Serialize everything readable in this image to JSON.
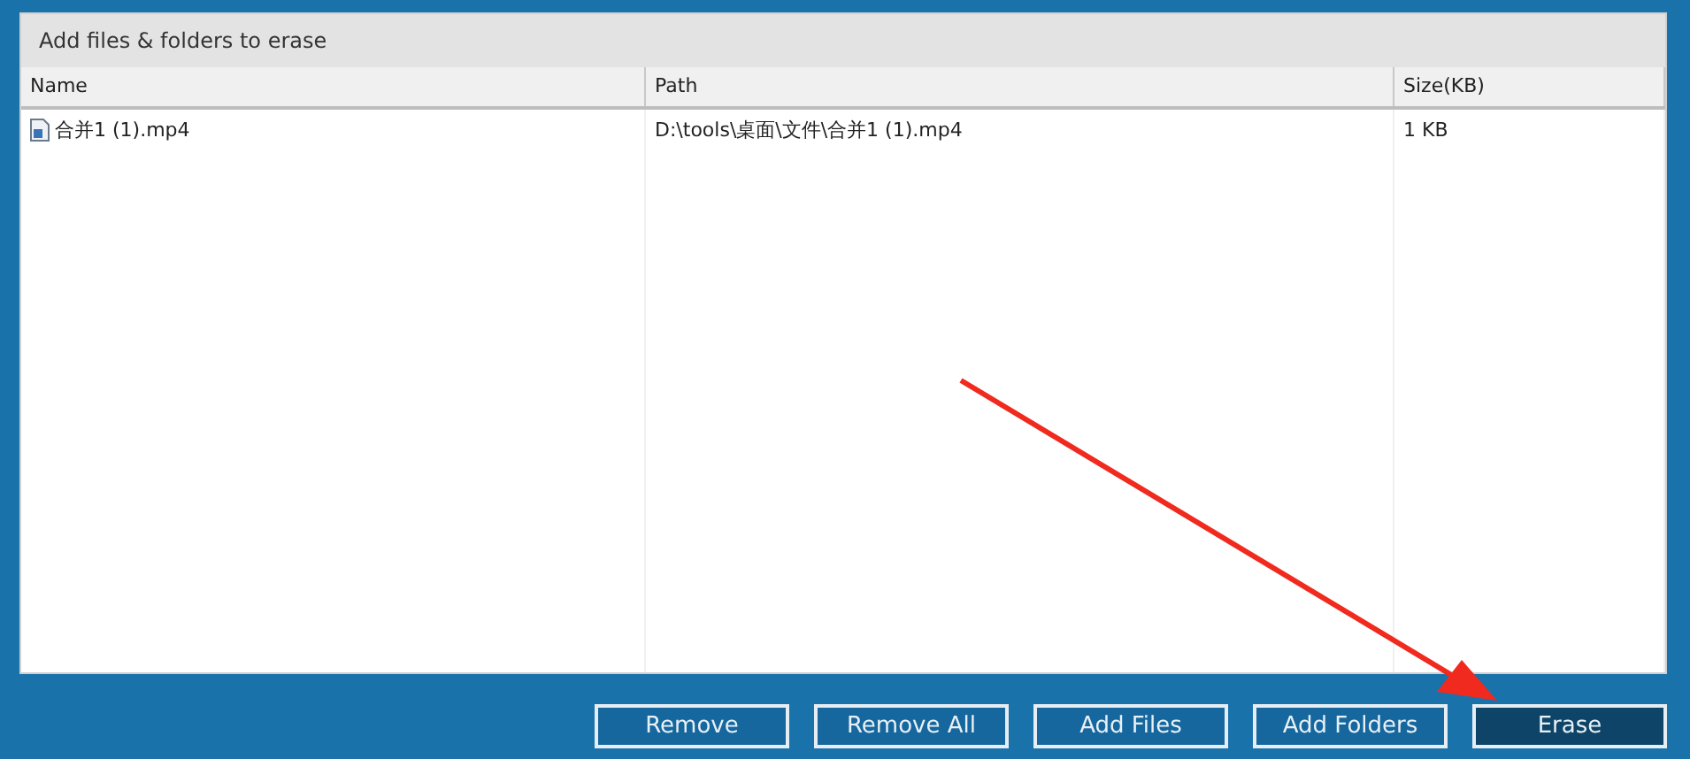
{
  "panel": {
    "title": "Add files & folders to erase"
  },
  "table": {
    "columns": [
      "Name",
      "Path",
      "Size(KB)"
    ],
    "rows": [
      {
        "name": "合并1 (1).mp4",
        "path": "D:\\tools\\桌面\\文件\\合并1 (1).mp4",
        "size": "1 KB"
      }
    ]
  },
  "buttons": [
    {
      "label": "Remove",
      "selected": false
    },
    {
      "label": "Remove All",
      "selected": false
    },
    {
      "label": "Add Files",
      "selected": false
    },
    {
      "label": "Add Folders",
      "selected": false
    },
    {
      "label": "Erase",
      "selected": true
    }
  ]
}
